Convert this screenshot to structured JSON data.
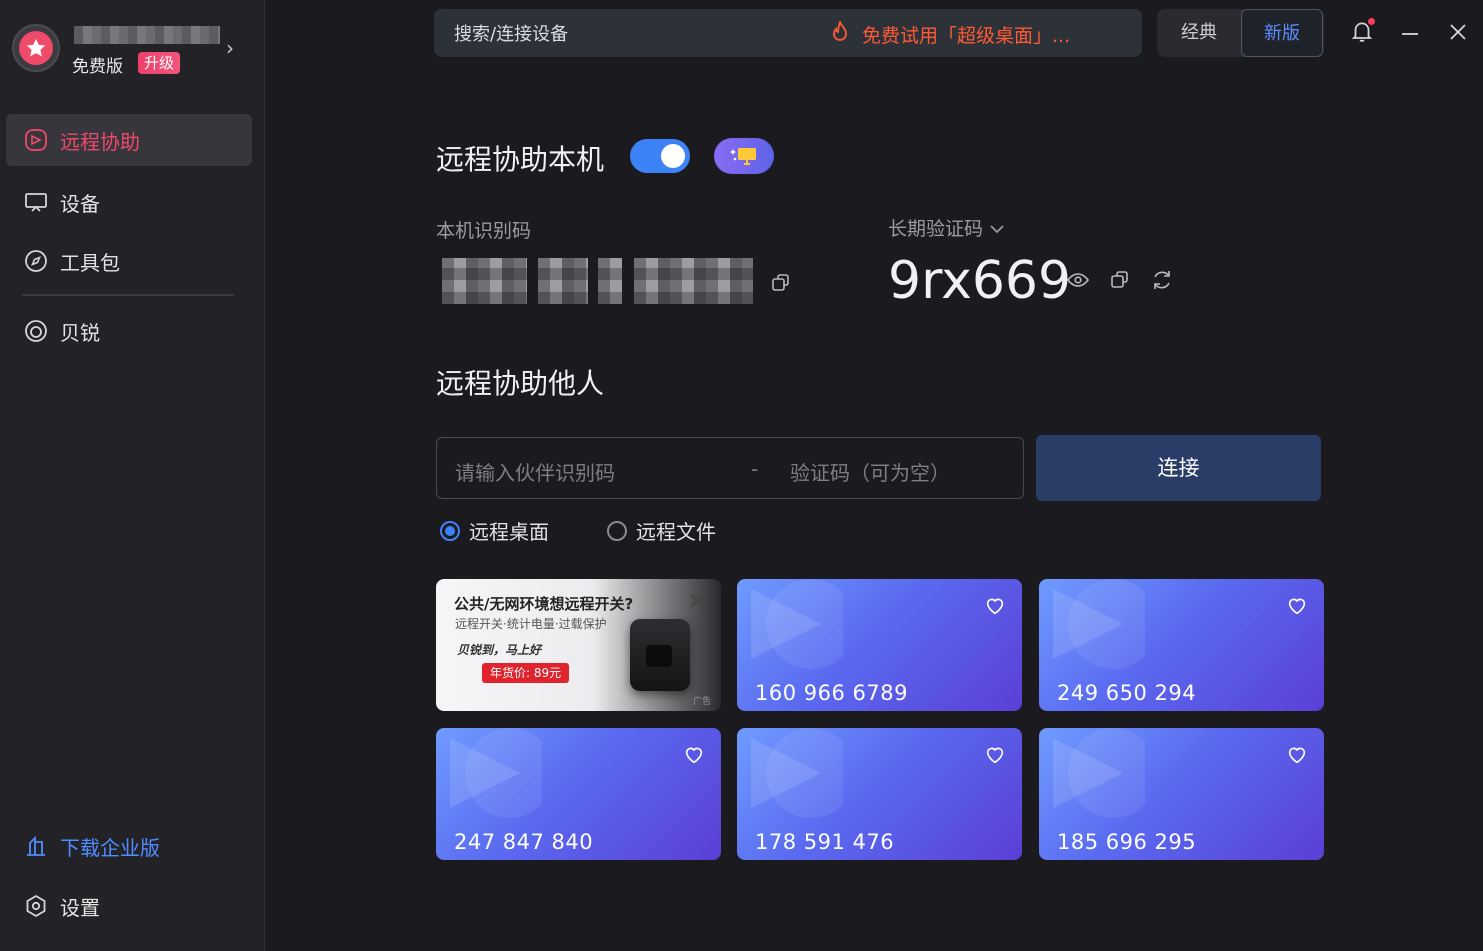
{
  "sidebar": {
    "account": {
      "plan": "免费版",
      "upgrade": "升级"
    },
    "items": [
      {
        "label": "远程协助",
        "icon": "remote-assist-icon",
        "active": true
      },
      {
        "label": "设备",
        "icon": "monitor-icon",
        "active": false
      },
      {
        "label": "工具包",
        "icon": "compass-icon",
        "active": false
      },
      {
        "label": "贝锐",
        "icon": "brand-icon",
        "active": false
      }
    ],
    "download_enterprise": "下载企业版",
    "settings": "设置"
  },
  "topbar": {
    "search_placeholder": "搜索/连接设备",
    "promo": "免费试用「超级桌面」...",
    "classic": "经典",
    "new_version": "新版"
  },
  "main": {
    "assist_self_title": "远程协助本机",
    "device_id_label": "本机识别码",
    "verify_label": "长期验证码",
    "verify_code": "9rx669",
    "assist_others_title": "远程协助他人",
    "partner_id_placeholder": "请输入伙伴识别码",
    "separator": "-",
    "verify_placeholder": "验证码（可为空）",
    "connect": "连接",
    "mode_desktop": "远程桌面",
    "mode_file": "远程文件"
  },
  "ad": {
    "title": "公共/无网环境想远程开关?",
    "subtitle": "远程开关·统计电量·过载保护",
    "slogan": "贝锐到，马上好",
    "price": "年货价: 89元",
    "tag": "广告"
  },
  "devices": [
    {
      "number": "160 966 6789"
    },
    {
      "number": "249 650 294"
    },
    {
      "number": "247 847 840"
    },
    {
      "number": "178 591 476"
    },
    {
      "number": "185 696 295"
    }
  ],
  "colors": {
    "accent_pink": "#f04a6a",
    "accent_blue": "#3d82f7",
    "promo_orange": "#ff5a36"
  }
}
